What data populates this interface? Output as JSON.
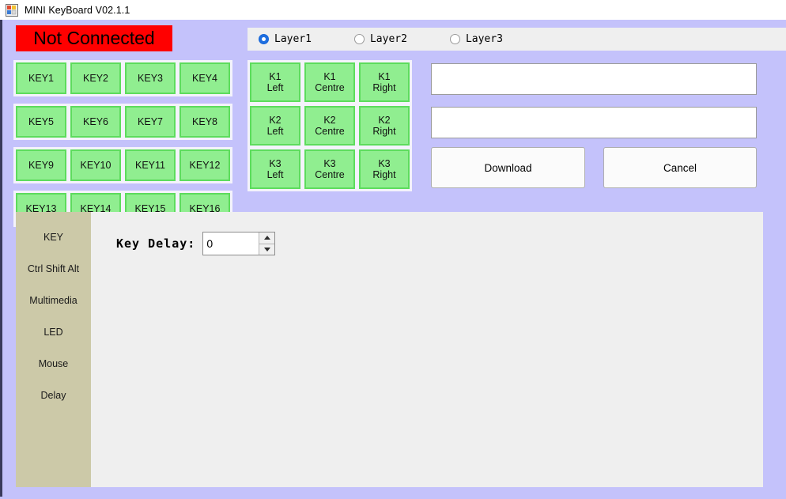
{
  "window": {
    "title": "MINI KeyBoard V02.1.1",
    "icon": "app-form-icon",
    "background_color": "#c4c2fb"
  },
  "status": {
    "text": "Not Connected",
    "background_color": "#ff0000",
    "text_color": "#000000"
  },
  "layers": {
    "selected": "Layer1",
    "options": [
      {
        "label": "Layer1",
        "checked": true
      },
      {
        "label": "Layer2",
        "checked": false
      },
      {
        "label": "Layer3",
        "checked": false
      }
    ]
  },
  "key_grid": {
    "button_color": "#90ee90",
    "border_color": "#5ddc5d",
    "buttons": [
      {
        "label": "KEY1"
      },
      {
        "label": "KEY2"
      },
      {
        "label": "KEY3"
      },
      {
        "label": "KEY4"
      },
      {
        "label": "KEY5"
      },
      {
        "label": "KEY6"
      },
      {
        "label": "KEY7"
      },
      {
        "label": "KEY8"
      },
      {
        "label": "KEY9"
      },
      {
        "label": "KEY10"
      },
      {
        "label": "KEY11"
      },
      {
        "label": "KEY12"
      },
      {
        "label": "KEY13"
      },
      {
        "label": "KEY14"
      },
      {
        "label": "KEY15"
      },
      {
        "label": "KEY16"
      }
    ]
  },
  "knob_grid": {
    "buttons": [
      {
        "line1": "K1",
        "line2": "Left"
      },
      {
        "line1": "K1",
        "line2": "Centre"
      },
      {
        "line1": "K1",
        "line2": "Right"
      },
      {
        "line1": "K2",
        "line2": "Left"
      },
      {
        "line1": "K2",
        "line2": "Centre"
      },
      {
        "line1": "K2",
        "line2": "Right"
      },
      {
        "line1": "K3",
        "line2": "Left"
      },
      {
        "line1": "K3",
        "line2": "Centre"
      },
      {
        "line1": "K3",
        "line2": "Right"
      }
    ]
  },
  "textboxes": [
    {
      "value": "",
      "placeholder": ""
    },
    {
      "value": "",
      "placeholder": ""
    }
  ],
  "actions": {
    "download_label": "Download",
    "cancel_label": "Cancel"
  },
  "sidebar": {
    "background_color": "#ccc9a8",
    "selected": "KEY",
    "items": [
      {
        "label": "KEY"
      },
      {
        "label": "Ctrl Shift Alt"
      },
      {
        "label": "Multimedia"
      },
      {
        "label": "LED"
      },
      {
        "label": "Mouse"
      },
      {
        "label": "Delay"
      }
    ]
  },
  "content": {
    "key_delay_label": "Key Delay:",
    "key_delay_value": "0"
  }
}
